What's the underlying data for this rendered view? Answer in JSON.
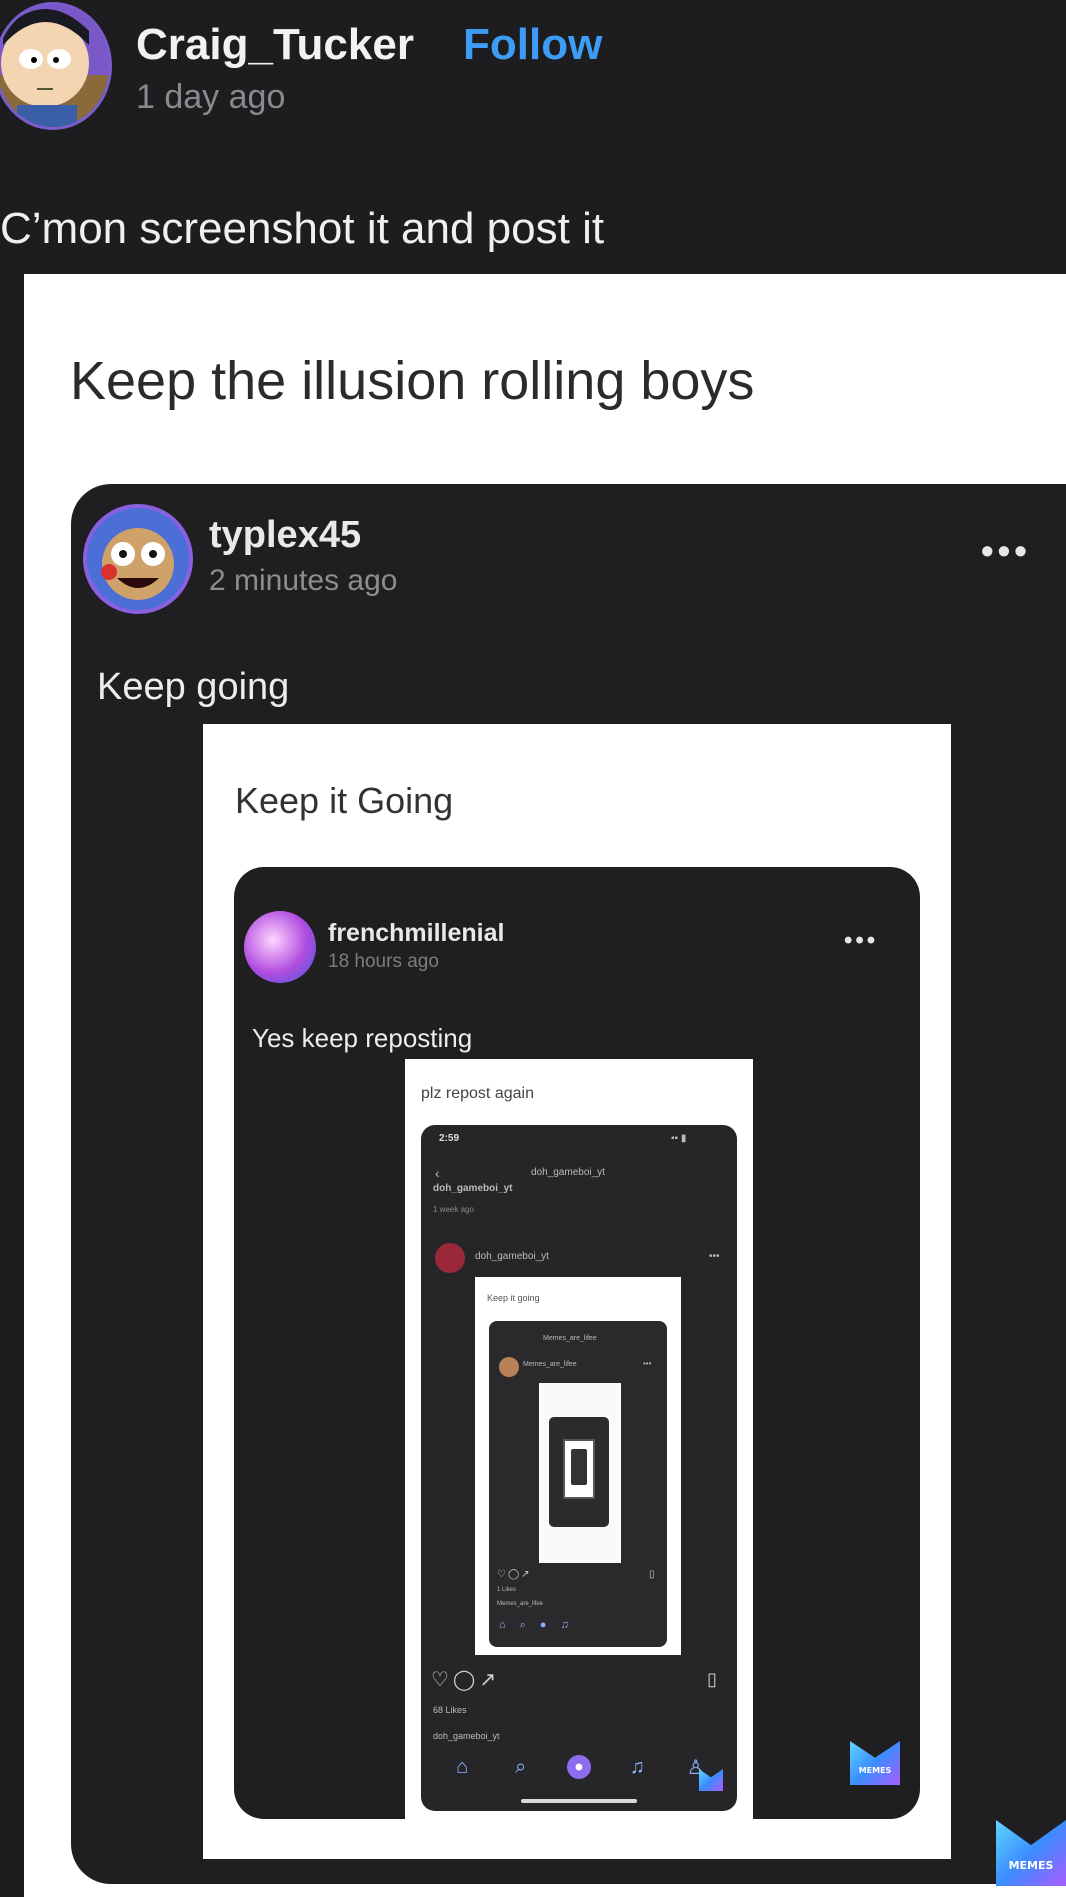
{
  "post": {
    "username": "Craig_Tucker",
    "follow_label": "Follow",
    "time": "1 day ago",
    "caption": "C’mon screenshot it and post it"
  },
  "shot": {
    "title": "Keep the illusion rolling boys",
    "card1": {
      "username": "typlex45",
      "time": "2 minutes ago",
      "more": "•••",
      "caption": "Keep going",
      "inner_title": "Keep it Going",
      "card2": {
        "username": "frenchmillenial",
        "time": "18 hours ago",
        "more": "•••",
        "caption": "Yes keep reposting",
        "inner_title": "plz repost again",
        "phone": {
          "status_time": "2:59",
          "header_user": "doh_gameboi_yt",
          "handle": "doh_gameboi_yt",
          "age": "1 week ago",
          "post_user": "doh_gameboi_yt",
          "more": "•••",
          "inner_title": "Keep it going",
          "likes": "68 Likes",
          "caption_user": "doh_gameboi_yt",
          "logo_text": "MEMES",
          "nested": {
            "header_user": "Memes_are_lifee",
            "post_user": "Memes_are_lifee",
            "more": "•••",
            "likes": "1 Likes",
            "caption_user": "Memes_are_lifee"
          }
        }
      }
    },
    "logo_text": "MEMES"
  },
  "icons": {
    "heart": "heart-icon",
    "comment": "comment-icon",
    "share": "share-icon",
    "bookmark": "bookmark-icon",
    "home": "home-icon",
    "search": "search-icon",
    "plus": "plus-icon",
    "bell": "bell-icon",
    "profile": "profile-icon"
  },
  "colors": {
    "background": "#1d1d1f",
    "follow": "#3d9cf5",
    "card": "#1f1f21",
    "accent": "#8d6cf0"
  }
}
